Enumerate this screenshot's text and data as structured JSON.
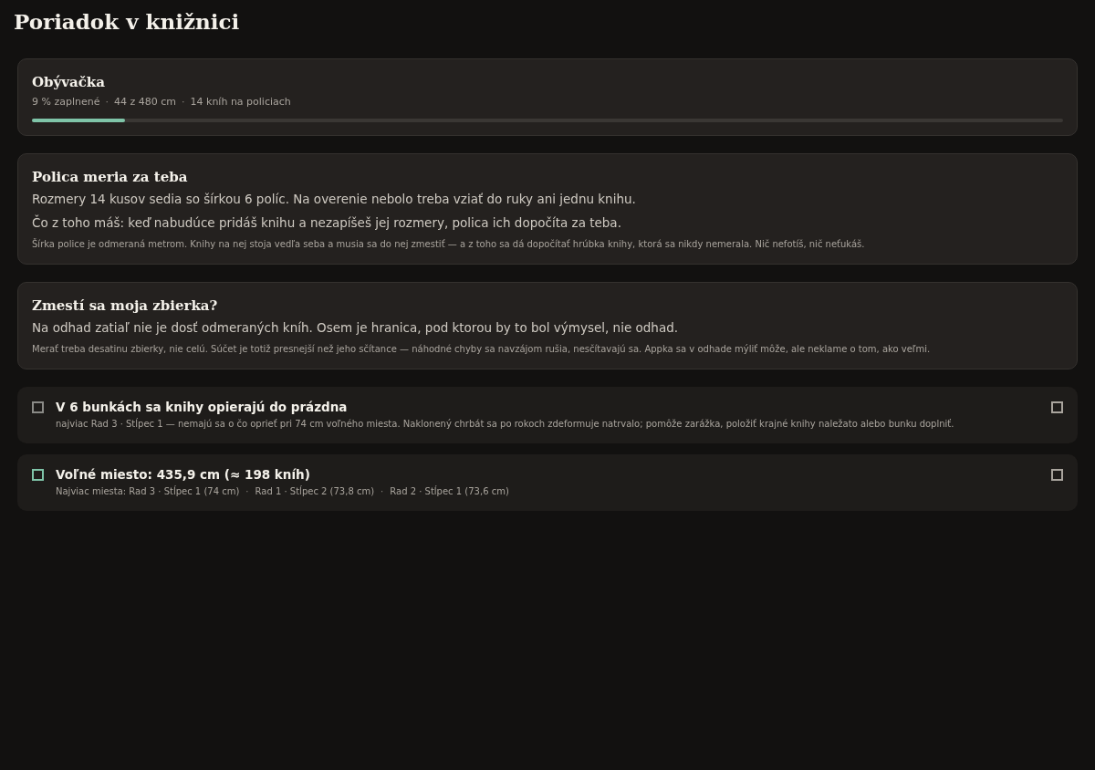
{
  "title": "Poriadok v knižnici",
  "summary": {
    "name": "Obývačka",
    "stats": [
      "9 % zaplnené",
      "44 z 480 cm",
      "14 kníh na policiach"
    ],
    "separator": "·",
    "level": 0.09
  },
  "cards": [
    {
      "heading": "Polica meria za teba",
      "lines": [
        "Rozmery 14 kusov sedia so šírkou 6 políc. Na overenie nebolo treba vziať do ruky ani jednu knihu.",
        "Čo z toho máš: keď nabudúce pridáš knihu a nezapíšeš jej rozmery, polica ich dopočíta za teba."
      ],
      "note": "Šírka police je odmeraná metrom. Knihy na nej stoja vedľa seba a musia sa do nej zmestiť — a z toho sa dá dopočítať hrúbka knihy, ktorá sa nikdy nemerala. Nič nefotíš, nič neťukáš."
    },
    {
      "heading": "Zmestí sa moja zbierka?",
      "lines": [
        "Na odhad zatiaľ nie je dosť odmeraných kníh. Osem je hranica, pod ktorou by to bol výmysel, nie odhad."
      ],
      "note": "Merať treba desatinu zbierky, nie celú. Súčet je totiž presnejší než jeho sčítance — náhodné chyby sa navzájom rušia, nesčítavajú sa. Appka sa v odhade mýliť môže, ale neklame o tom, ako veľmi."
    }
  ],
  "notices": [
    {
      "color": "#8a8a86",
      "title": "V 6 bunkách sa knihy opierajú do prázdna",
      "details": [
        "najviac Rad 3 · Stĺpec 1 — nemajú sa o čo oprieť pri 74 cm voľného miesta. Naklonený chrbát sa po rokoch zdeformuje natrvalo; pomôže zarážka, položiť krajné knihy naležato alebo bunku doplniť."
      ]
    },
    {
      "color": "#7fc4a8",
      "title": "Voľné miesto: 435,9 cm (≈ 198 kníh)",
      "details": [
        "Najviac miesta: Rad 3 · Stĺpec 1 (74 cm)",
        "Rad 1 · Stĺpec 2 (73,8 cm)",
        "Rad 2 · Stĺpec 1 (73,6 cm)"
      ],
      "separator": "·"
    }
  ]
}
